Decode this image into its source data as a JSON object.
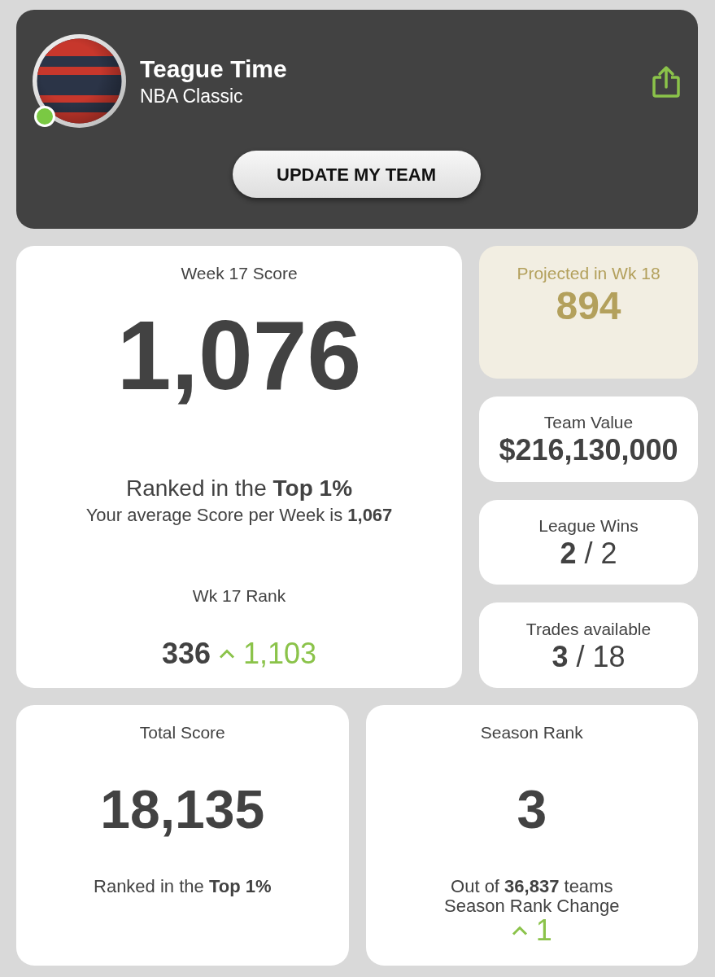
{
  "header": {
    "team_name": "Teague Time",
    "league": "NBA Classic",
    "online": true,
    "button": "UPDATE MY TEAM"
  },
  "week_score": {
    "title": "Week 17 Score",
    "score": "1,076",
    "rank_text": "Ranked in the **Top 1%**",
    "average_text": "Your average Score per Week is **1,067**",
    "rank_label": "Wk 17 Rank",
    "rank": "336",
    "rank_change": {
      "rising": true,
      "value": "1,103"
    }
  },
  "stats": [
    {
      "kind": "highlight",
      "label": "Projected in Wk 18",
      "value": "894"
    },
    {
      "kind": "plain",
      "label": "Team Value",
      "value": "$216,130,000"
    },
    {
      "kind": "ratio",
      "label": "League Wins",
      "value": "**2** / 2"
    },
    {
      "kind": "ratio",
      "label": "Trades available",
      "value": "**3** / 18"
    }
  ],
  "total_score": {
    "title": "Total Score",
    "score": "18,135",
    "rank_text": "Ranked in the **Top 1%**"
  },
  "season_rank": {
    "title": "Season Rank",
    "rank": "3",
    "teams_text": "Out of **36,837** teams",
    "change_label": "Season Rank Change",
    "change": {
      "rising": true,
      "value": "1"
    }
  }
}
